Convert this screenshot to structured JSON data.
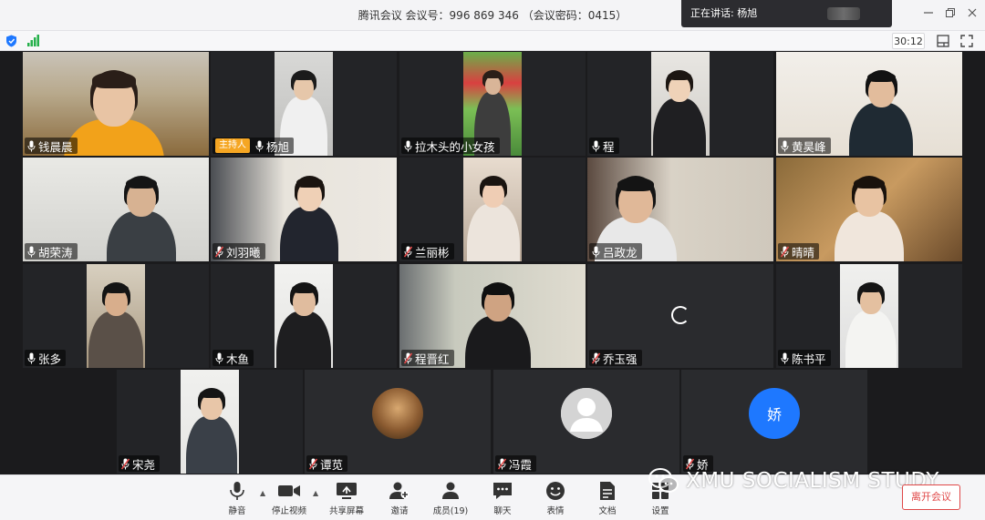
{
  "app": {
    "title": "腾讯会议 会议号：996 869 346 （会议密码：0415）"
  },
  "speaking": {
    "label": "正在讲话: 杨旭"
  },
  "timer": "30:12",
  "icons": {
    "shield": "shield-icon",
    "signal": "signal-strength-icon",
    "layout": "layout-icon",
    "fullscreen": "fullscreen-icon",
    "minimize": "minimize-icon",
    "restore": "restore-icon",
    "close": "close-icon"
  },
  "host_badge": "主持人",
  "participants": [
    {
      "name": "钱晨晨",
      "mic": "on"
    },
    {
      "name": "杨旭",
      "mic": "on",
      "host": true
    },
    {
      "name": "拉木头的小女孩",
      "mic": "on"
    },
    {
      "name": "程",
      "mic": "on"
    },
    {
      "name": "黄昊峰",
      "mic": "on"
    },
    {
      "name": "胡荣涛",
      "mic": "on"
    },
    {
      "name": "刘羽曦",
      "mic": "muted"
    },
    {
      "name": "兰丽彬",
      "mic": "muted"
    },
    {
      "name": "吕政龙",
      "mic": "on"
    },
    {
      "name": "晴晴",
      "mic": "muted"
    },
    {
      "name": "张多",
      "mic": "on"
    },
    {
      "name": "木鱼",
      "mic": "on"
    },
    {
      "name": "程晋红",
      "mic": "muted"
    },
    {
      "name": "乔玉强",
      "mic": "muted"
    },
    {
      "name": "陈书平",
      "mic": "on"
    },
    {
      "name": "宋尧",
      "mic": "muted"
    },
    {
      "name": "谭苋",
      "mic": "muted"
    },
    {
      "name": "冯霞",
      "mic": "muted"
    },
    {
      "name": "娇",
      "mic": "muted",
      "avatar_text": "娇"
    }
  ],
  "toolbar": {
    "mute": "静音",
    "stop_video": "停止视频",
    "share_screen": "共享屏幕",
    "invite": "邀请",
    "members": "成员(19)",
    "chat": "聊天",
    "reactions": "表情",
    "docs": "文档",
    "settings": "设置",
    "leave": "离开会议"
  },
  "watermark": "XMU SOCIALISM STUDY",
  "colors": {
    "accent": "#1e78ff",
    "host_badge": "#f5a623",
    "leave": "#e04848",
    "muted_mic": "#e04848"
  }
}
